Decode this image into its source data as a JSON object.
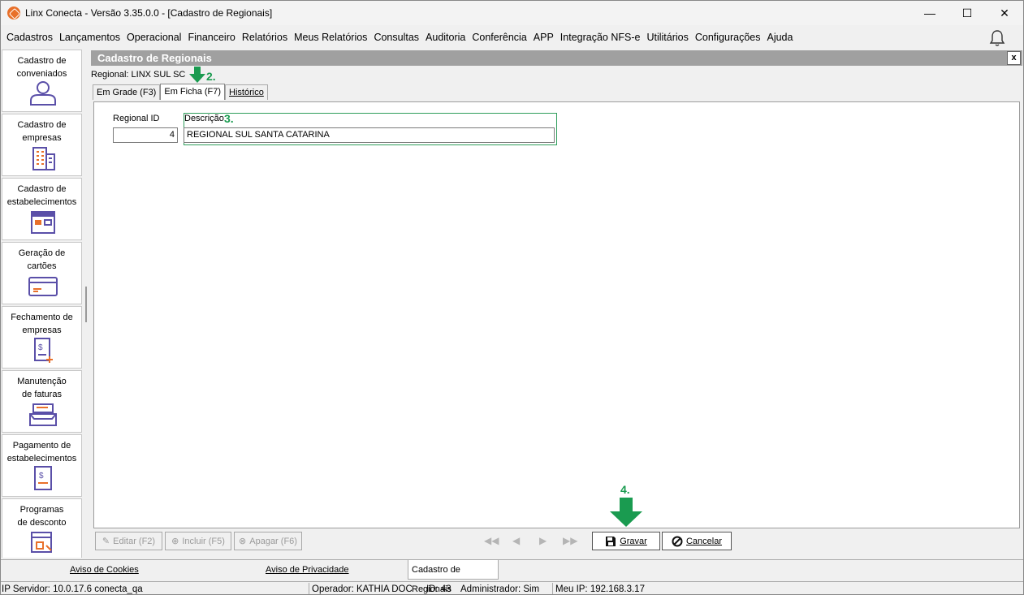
{
  "window": {
    "title": "Linx Conecta - Versão 3.35.0.0 - [Cadastro de Regionais]",
    "minimize": "—",
    "maximize": "☐",
    "close": "✕"
  },
  "menu": [
    "Cadastros",
    "Lançamentos",
    "Operacional",
    "Financeiro",
    "Relatórios",
    "Meus Relatórios",
    "Consultas",
    "Auditoria",
    "Conferência",
    "APP",
    "Integração NFS-e",
    "Utilitários",
    "Configurações",
    "Ajuda"
  ],
  "sidebar": [
    {
      "line1": "Cadastro de",
      "line2": "conveniados",
      "icon": "user-icon"
    },
    {
      "line1": "Cadastro de",
      "line2": "empresas",
      "icon": "building-icon"
    },
    {
      "line1": "Cadastro de",
      "line2": "estabelecimentos",
      "icon": "store-icon"
    },
    {
      "line1": "Geração de",
      "line2": "cartões",
      "icon": "card-icon"
    },
    {
      "line1": "Fechamento de",
      "line2": "empresas",
      "icon": "invoice-icon"
    },
    {
      "line1": "Manutenção",
      "line2": "de faturas",
      "icon": "inbox-icon"
    },
    {
      "line1": "Pagamento de",
      "line2": "estabelecimentos",
      "icon": "payment-icon"
    },
    {
      "line1": "Programas",
      "line2": "de desconto",
      "icon": "discount-icon"
    }
  ],
  "panel": {
    "title": "Cadastro de Regionais",
    "close": "x",
    "regional": "Regional: LINX SUL SC",
    "tabs": [
      "Em Grade (F3)",
      "Em Ficha (F7)",
      "Histórico"
    ]
  },
  "form": {
    "regional_id_label": "Regional ID",
    "regional_id_value": "4",
    "descricao_label": "Descrição",
    "descricao_value": "REGIONAL SUL SANTA CATARINA"
  },
  "annotations": {
    "step2": "2.",
    "step3": "3.",
    "step4": "4."
  },
  "toolbar": {
    "editar": "Editar (F2)",
    "incluir": "Incluir (F5)",
    "apagar": "Apagar (F6)",
    "gravar": "Gravar",
    "cancelar": "Cancelar"
  },
  "bottom_tabs": [
    "Aviso de Cookies",
    "Aviso de Privacidade",
    "Cadastro de Regionais"
  ],
  "status": {
    "servidor": "IP Servidor: 10.0.17.6 conecta_qa",
    "operador": "Operador: KATHIA DOC",
    "id": "ID: 43",
    "admin": "Administrador: Sim",
    "ip": "Meu IP: 192.168.3.17"
  },
  "colors": {
    "accent_green": "#1a9b50",
    "header_gray": "#a0a0a0",
    "icon_orange": "#e8702a",
    "icon_purple": "#5a4fa8"
  }
}
